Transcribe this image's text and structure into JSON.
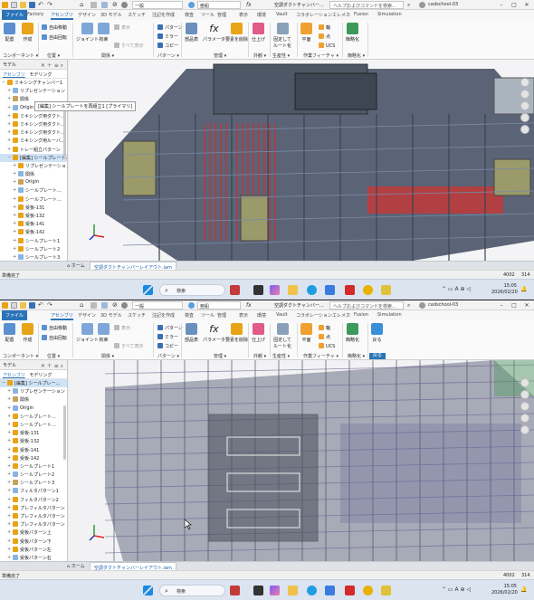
{
  "shots": [
    {
      "titlebar": {
        "units_select": "一般",
        "appearance_select": "亜鉛",
        "doc_title": "空調ダクトチャンバー...",
        "help_search": "ヘルプおよびコマンドを検索...",
        "user": "cadschool-03"
      },
      "tabs": [
        "ファイル",
        "Factory",
        "アセンブリ",
        "デザイン",
        "3D モデル",
        "スケッチ",
        "注記を作成",
        "検査",
        "ツール",
        "管理",
        "表示",
        "環境",
        "Vault",
        "コラボレーション",
        "エレメカ",
        "Fusion",
        "Simulation"
      ],
      "ribbon": {
        "place": "配置",
        "create": "作成",
        "free_move": "自由移動",
        "free_rotate": "自由回転",
        "joint": "ジョイント",
        "constrain": "拘束",
        "show": "表示",
        "show_all": "すべて表示",
        "pattern": "パターン",
        "mirror": "ミラー",
        "copy": "コピー",
        "bom": "部品表",
        "parameters": "パラメータ",
        "delete_face": "要素を削除",
        "shrinkwrap": "仕上げ",
        "fix_route": "固定して\nルート化",
        "plane": "平面",
        "axis": "軸",
        "point": "点",
        "ucs": "UCS",
        "simplify": "簡略化",
        "panels": [
          "コンポーネント",
          "位置",
          "関係",
          "パターン",
          "管理",
          "外観",
          "生産性",
          "作業フィーチャ",
          "簡略化"
        ]
      },
      "browser": {
        "title": "モデル",
        "tab_assembly": "アセンブリ",
        "tab_modeling": "モデリング",
        "tooltip": "[編集] シールプレートを再組立1 [プライマリ]",
        "items": [
          "ミキシングチャンバー1",
          "リプレゼンテーション",
          "関係",
          "Origin",
          "ミキシング用ダクト...",
          "ミキシング用ダクト...",
          "ミキシング用ダクト...",
          "ミキシング用ルーバ...",
          "トレー組立パターン",
          "[編集] シールプレート...",
          "リプレゼンテーション",
          "関係",
          "Origin",
          "シールプレート...",
          "シールプレート...",
          "受板-131",
          "受板-132",
          "受板-141",
          "受板-142",
          "シールプレート1",
          "シールプレート2",
          "シールプレート3",
          "シールプレート4"
        ]
      },
      "doc_tab": "空調ダクトチャンバーレイアウト.iam",
      "home_label": "ホーム",
      "status": "準備完了",
      "status_num1": "4002",
      "status_num2": "314",
      "taskbar": {
        "search": "検索",
        "time": "15:05",
        "date": "2026/02/20"
      }
    },
    {
      "titlebar": {
        "units_select": "一般",
        "appearance_select": "亜鉛",
        "doc_title": "空調ダクトチャンバー...",
        "help_search": "ヘルプおよびコマンドを検索...",
        "user": "cadschool-03"
      },
      "tabs": [
        "ファイル",
        "アセンブリ",
        "デザイン",
        "3D モデル",
        "スケッチ",
        "注記を作成",
        "検査",
        "ツール",
        "管理",
        "表示",
        "環境",
        "Vault",
        "コラボレーション",
        "エレメカ",
        "Fusion",
        "Simulation"
      ],
      "ribbon": {
        "place": "配置",
        "create": "作成",
        "free_move": "自由移動",
        "free_rotate": "自由回転",
        "joint": "ジョイント",
        "constrain": "拘束",
        "show": "表示",
        "show_all": "すべて表示",
        "pattern": "パターン",
        "mirror": "ミラー",
        "copy": "コピー",
        "bom": "部品表",
        "parameters": "パラメータ",
        "delete_face": "要素を削除",
        "shrinkwrap": "仕上げ",
        "fix_route": "固定して\nルート化",
        "plane": "平面",
        "axis": "軸",
        "point": "点",
        "ucs": "UCS",
        "simplify": "簡略化",
        "return": "戻る",
        "panels": [
          "コンポーネント",
          "位置",
          "関係",
          "パターン",
          "管理",
          "外観",
          "生産性",
          "作業フィーチャ",
          "簡略化",
          "戻る"
        ]
      },
      "browser": {
        "title": "モデル",
        "tab_assembly": "アセンブリ",
        "tab_modeling": "モデリング",
        "tooltip": "",
        "items": [
          "[編集] シールプレー...",
          "リプレゼンテーション",
          "関係",
          "Origin",
          "シールプレート...",
          "シールプレート...",
          "受板-131",
          "受板-132",
          "受板-141",
          "受板-142",
          "シールプレート1",
          "シールプレート2",
          "シールプレート3",
          "フィルタパターン1",
          "フィルタパターン2",
          "プレフィルタパターン",
          "プレフィルタパターン",
          "プレフィルタパターン",
          "受板パターン上",
          "受板パターン下",
          "受板パターン左",
          "受板パターン右",
          "シールプレート5"
        ]
      },
      "doc_tab": "空調ダクトチャンバーレイアウト.iam",
      "home_label": "ホーム",
      "status": "準備完了",
      "status_num1": "4002",
      "status_num2": "314",
      "taskbar": {
        "search": "検索",
        "time": "15:05",
        "date": "2026/02/20"
      }
    }
  ],
  "colors": {
    "accent": "#2b74b8",
    "model_wire_dark": "#39424f",
    "model_red": "#e0202a",
    "model_olive": "#9a9a6a",
    "model_translucent": "#6a7085"
  }
}
